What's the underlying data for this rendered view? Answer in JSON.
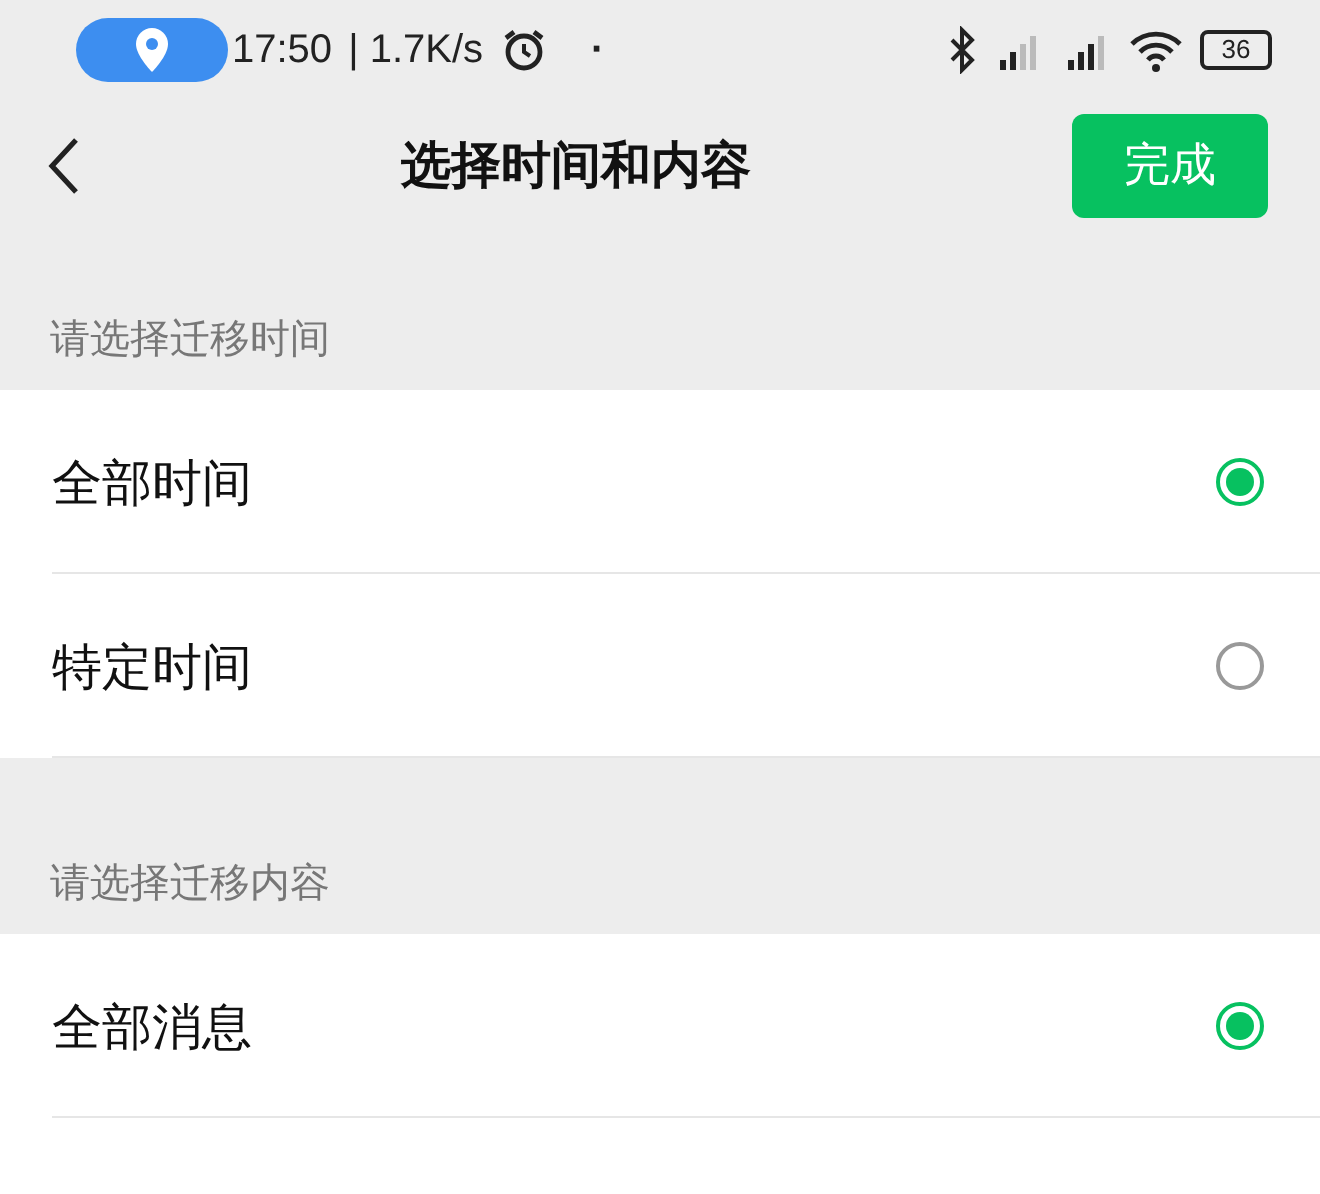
{
  "status_bar": {
    "time": "17:50",
    "speed": "| 1.7K/s",
    "dot": "·",
    "battery": "36"
  },
  "nav": {
    "title": "选择时间和内容",
    "done": "完成"
  },
  "sections": [
    {
      "header": "请选择迁移时间",
      "options": [
        {
          "label": "全部时间",
          "selected": true
        },
        {
          "label": "特定时间",
          "selected": false
        }
      ]
    },
    {
      "header": "请选择迁移内容",
      "options": [
        {
          "label": "全部消息",
          "selected": true
        }
      ]
    }
  ]
}
